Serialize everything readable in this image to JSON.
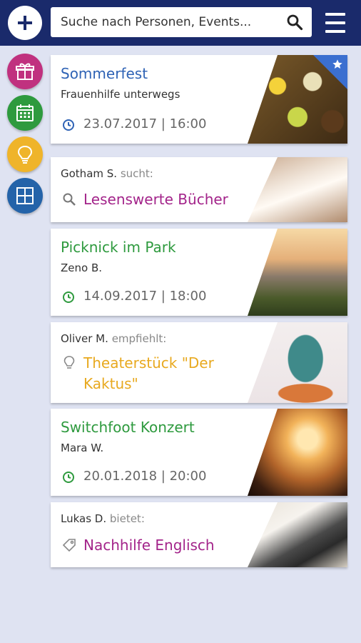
{
  "header": {
    "search_placeholder": "Suche nach Personen, Events..."
  },
  "sidebar": [
    "gift-icon",
    "calendar-icon",
    "lightbulb-icon",
    "grid-icon"
  ],
  "colors": {
    "header_bg": "#1a2a6b",
    "gift": "#c0317f",
    "calendar": "#2e9a3e",
    "lightbulb": "#efb42a",
    "grid": "#2463a9",
    "blue_title": "#2f63b5",
    "green_title": "#2e9a3e",
    "purple_title": "#a3248a",
    "yellow_title": "#e8a91f"
  },
  "cards": [
    {
      "title": "Sommerfest",
      "subtitle": "Frauenhilfe unterwegs",
      "date": "23.07.2017 | 16:00",
      "starred": true
    },
    {
      "author": "Gotham S.",
      "verb": "sucht:",
      "title": "Lesenswerte Bücher"
    },
    {
      "title": "Picknick im Park",
      "subtitle": "Zeno B.",
      "date": "14.09.2017 | 18:00"
    },
    {
      "author": "Oliver M.",
      "verb": "empfiehlt:",
      "title_line1": "Theaterstück \"Der",
      "title_line2": "Kaktus\""
    },
    {
      "title": "Switchfoot Konzert",
      "subtitle": "Mara W.",
      "date": "20.01.2018 | 20:00"
    },
    {
      "author": "Lukas D.",
      "verb": "bietet:",
      "title": "Nachhilfe Englisch"
    }
  ]
}
